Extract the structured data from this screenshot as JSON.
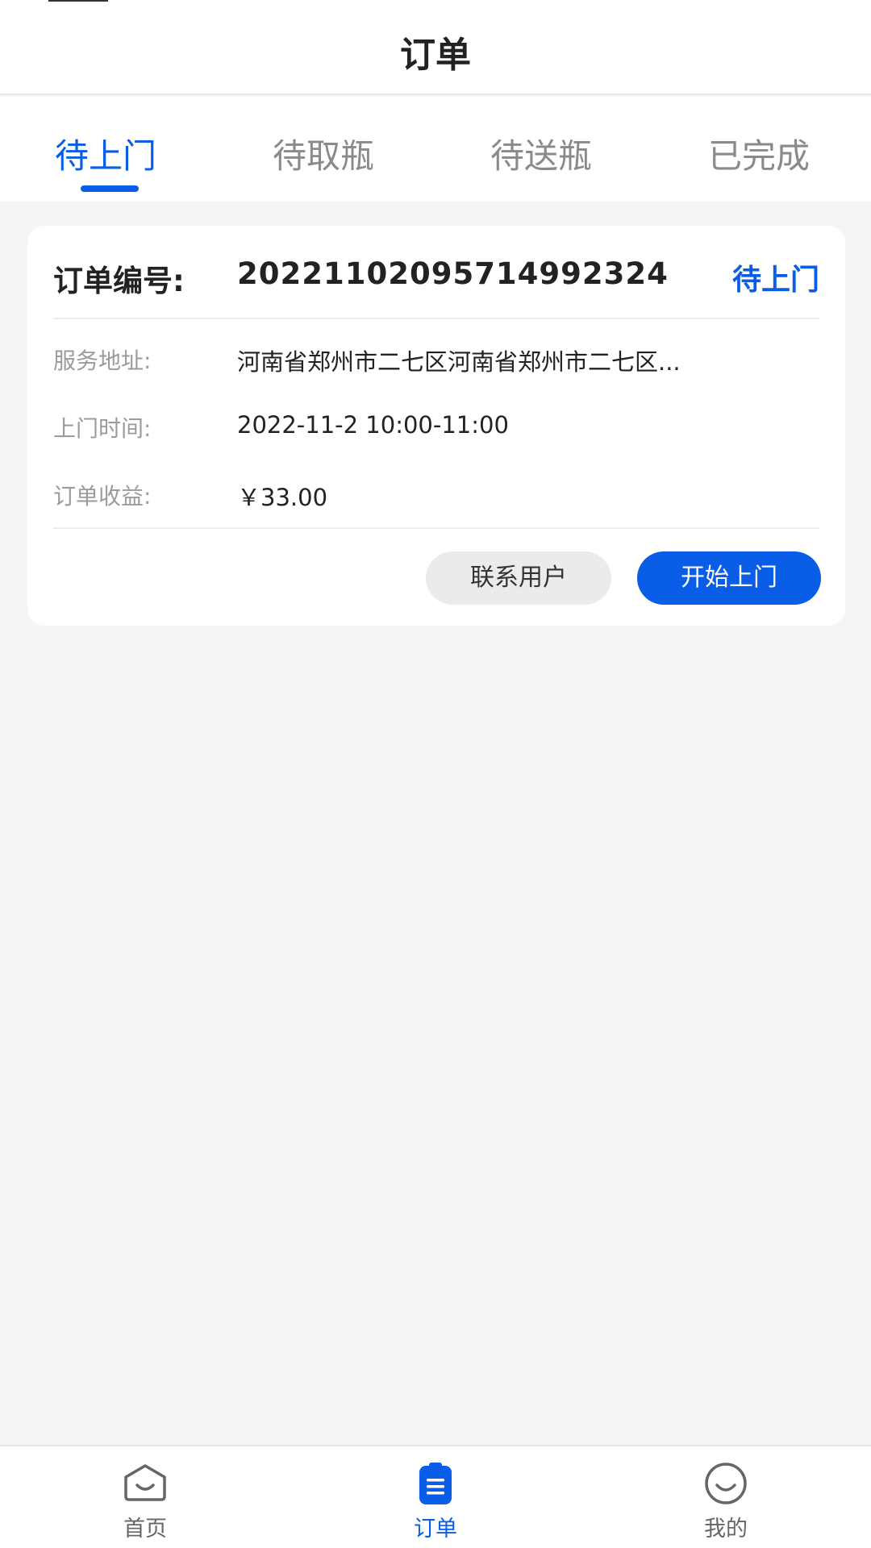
{
  "header": {
    "title": "订单"
  },
  "tabs": [
    {
      "label": "待上门",
      "active": true
    },
    {
      "label": "待取瓶",
      "active": false
    },
    {
      "label": "待送瓶",
      "active": false
    },
    {
      "label": "已完成",
      "active": false
    }
  ],
  "order": {
    "number_label": "订单编号:",
    "number": "20221102095714992324",
    "status": "待上门",
    "fields": [
      {
        "label": "服务地址:",
        "value": "河南省郑州市二七区河南省郑州市二七区..."
      },
      {
        "label": "上门时间:",
        "value": "2022-11-2 10:00-11:00"
      },
      {
        "label": "订单收益:",
        "value": "￥33.00"
      }
    ],
    "contact_button": "联系用户",
    "start_button": "开始上门"
  },
  "tabbar": [
    {
      "label": "首页",
      "icon": "home-icon",
      "active": false
    },
    {
      "label": "订单",
      "icon": "clipboard-icon",
      "active": true
    },
    {
      "label": "我的",
      "icon": "profile-icon",
      "active": false
    }
  ],
  "colors": {
    "accent": "#0a5de6",
    "background": "#f5f5f5",
    "muted": "#9b9b9b"
  }
}
